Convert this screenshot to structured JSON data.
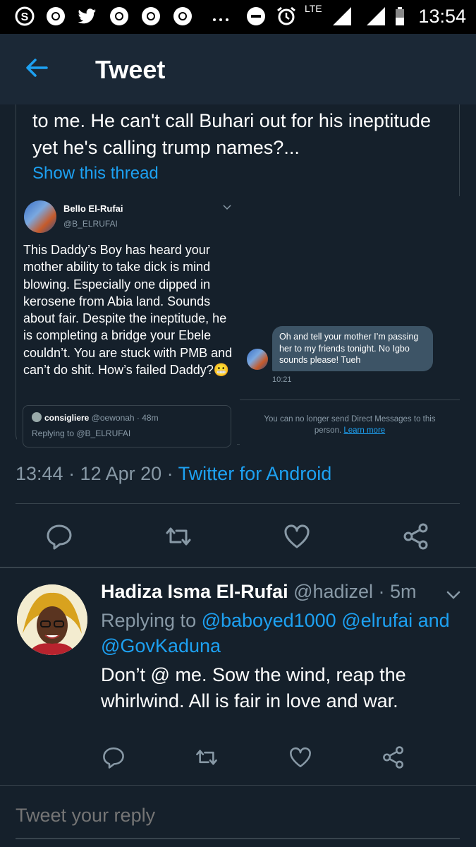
{
  "status_bar": {
    "time": "13:54",
    "network": "LTE",
    "icons": [
      "s-icon",
      "chrome-icon",
      "twitter-icon",
      "chrome-icon",
      "chrome-icon",
      "chrome-icon",
      "more-dots-icon",
      "do-not-disturb-icon",
      "alarm-icon",
      "signal-icon",
      "signal-icon",
      "battery-icon"
    ]
  },
  "app_bar": {
    "title": "Tweet",
    "back_icon": "back-arrow-icon"
  },
  "main_tweet": {
    "quoted_text": "to me. He can't call Buhari out for his ineptitude yet he's calling trump names?...",
    "show_thread": "Show this thread",
    "embedded_left": {
      "name": "Bello El-Rufai",
      "handle": "@B_ELRUFAI",
      "body": "This Daddy’s Boy has heard your mother ability to take dick is mind blowing. Especially one dipped in kerosene from Abia land. Sounds about fair. Despite the ineptitude, he is completing a bridge your Ebele couldn’t. You are stuck with PMB and can’t do shit. How’s failed Daddy?😬",
      "quoted_name": "consigliere",
      "quoted_handle": "@oewonah · 48m",
      "quoted_replying": "Replying to @B_ELRUFAI"
    },
    "embedded_right": {
      "message": "Oh and tell your mother I’m passing her to my friends tonight. No Igbo sounds please! Tueh",
      "time": "10:21",
      "notice": "You can no longer send Direct Messages to this person.",
      "learn_more": "Learn more"
    },
    "time": "13:44 · 12 Apr 20 · ",
    "source": "Twitter for Android",
    "actions": [
      "reply-icon",
      "retweet-icon",
      "like-icon",
      "share-icon"
    ]
  },
  "reply_tweet": {
    "name": "Hadiza Isma El-Rufai",
    "handle": " @hadizel · 5m",
    "replying_prefix": "Replying to ",
    "mention_1": "@baboyed1000",
    "mention_2": "@elrufai",
    "and": " and",
    "mention_3": "@GovKaduna",
    "text": "Don’t @ me. Sow the wind, reap the whirlwind. All is fair in love and war.",
    "actions": [
      "reply-icon",
      "retweet-icon",
      "like-icon",
      "share-icon"
    ]
  },
  "composer": {
    "placeholder": "Tweet your reply"
  },
  "colors": {
    "background": "#15202b",
    "accent": "#1da1f2",
    "muted": "#8899a6",
    "divider": "#38444d"
  }
}
